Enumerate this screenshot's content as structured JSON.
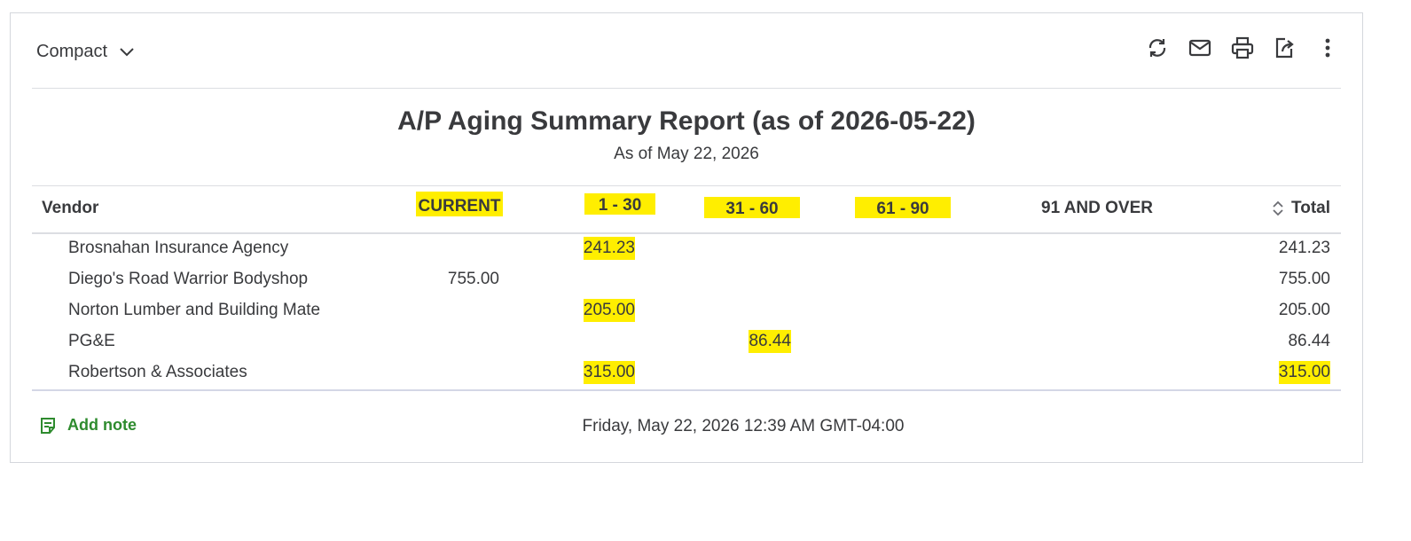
{
  "toolbar": {
    "view_label": "Compact",
    "icons": [
      "refresh-icon",
      "email-icon",
      "print-icon",
      "export-icon",
      "more-icon"
    ]
  },
  "report": {
    "title": "A/P Aging Summary Report (as of 2026-05-22)",
    "subtitle": "As of May 22, 2026"
  },
  "table": {
    "headers": {
      "vendor": "Vendor",
      "current": "CURRENT",
      "d1_30": "1 - 30",
      "d31_60": "31 - 60",
      "d61_90": "61 - 90",
      "d91_over": "91 AND OVER",
      "total": "Total"
    },
    "rows": [
      {
        "vendor": "Brosnahan Insurance Agency",
        "current": "",
        "d1_30": "241.23",
        "d31_60": "",
        "d61_90": "",
        "d91_over": "",
        "total": "241.23"
      },
      {
        "vendor": "Diego's Road Warrior Bodyshop",
        "current": "755.00",
        "d1_30": "",
        "d31_60": "",
        "d61_90": "",
        "d91_over": "",
        "total": "755.00"
      },
      {
        "vendor": "Norton Lumber and Building Mate",
        "current": "",
        "d1_30": "205.00",
        "d31_60": "",
        "d61_90": "",
        "d91_over": "",
        "total": "205.00"
      },
      {
        "vendor": "PG&E",
        "current": "",
        "d1_30": "",
        "d31_60": "86.44",
        "d61_90": "",
        "d91_over": "",
        "total": "86.44"
      },
      {
        "vendor": "Robertson & Associates",
        "current": "",
        "d1_30": "315.00",
        "d31_60": "",
        "d61_90": "",
        "d91_over": "",
        "total": "315.00"
      }
    ]
  },
  "footer": {
    "add_note_label": "Add note",
    "timestamp": "Friday, May 22, 2026 12:39 AM GMT-04:00"
  },
  "colors": {
    "highlight": "#ffee00",
    "text": "#393a3d",
    "accent_green": "#2e8b2e",
    "rule": "#dcdee2"
  }
}
